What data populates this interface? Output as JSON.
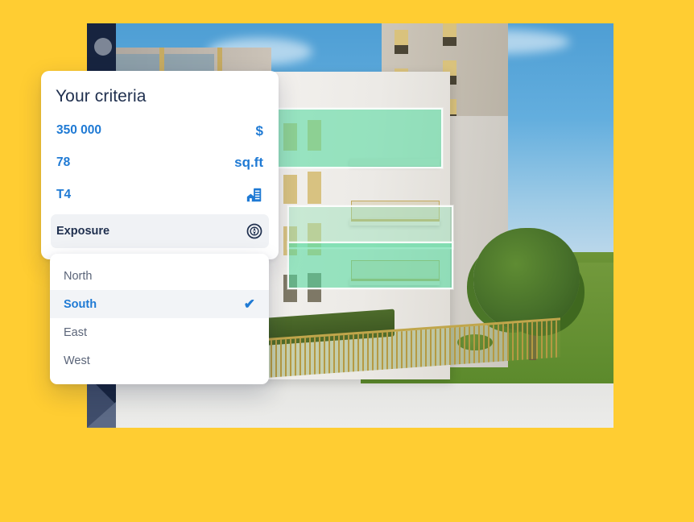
{
  "theme": {
    "background": "#FFCD32",
    "accent_blue": "#1F7AD4",
    "navy": "#20304F",
    "muted_text": "#5B6579",
    "row_highlight": "#F0F2F5",
    "highlight_green": "#56DBA0"
  },
  "card": {
    "title": "Your criteria",
    "rows": [
      {
        "name": "price",
        "value": "350 000",
        "unit": "$",
        "unit_icon": "dollar-icon"
      },
      {
        "name": "surface",
        "value": "78",
        "unit": "sq.ft",
        "unit_icon": "area-unit-label"
      },
      {
        "name": "type",
        "value": "T4",
        "unit": "",
        "unit_icon": "building-icon"
      },
      {
        "name": "exposure",
        "value": "Exposure",
        "unit": "",
        "unit_icon": "compass-icon"
      }
    ]
  },
  "dropdown": {
    "name": "exposure-options",
    "selected": "South",
    "check_glyph": "✔",
    "options": [
      {
        "label": "North",
        "selected": false
      },
      {
        "label": "South",
        "selected": true
      },
      {
        "label": "East",
        "selected": false
      },
      {
        "label": "West",
        "selected": false
      }
    ]
  },
  "image": {
    "name": "property-3d-rendering",
    "alt": "3D architectural rendering of a residential building with highlighted apartment volumes"
  }
}
